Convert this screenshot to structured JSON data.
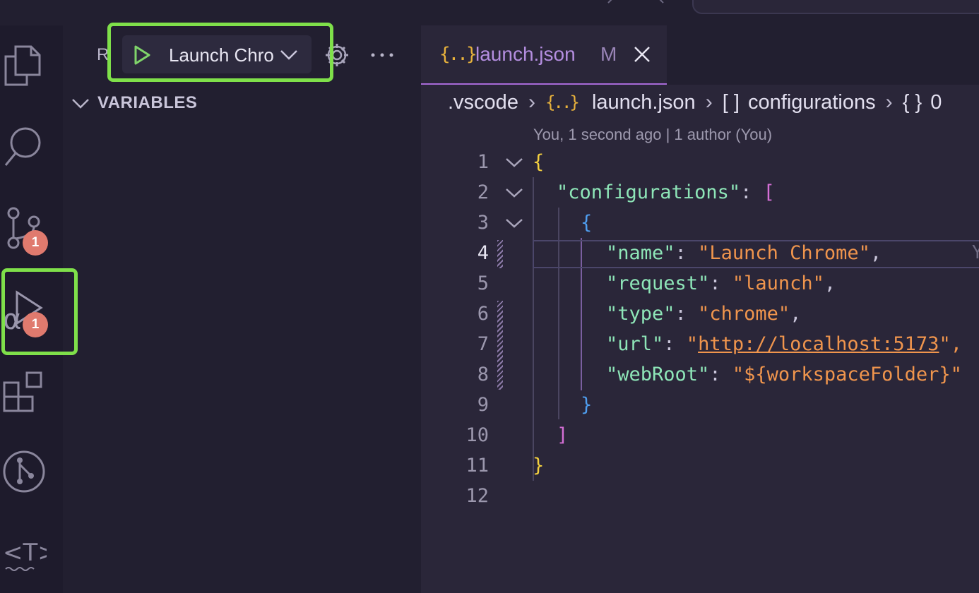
{
  "sidebar": {
    "title_truncated": "R",
    "launch_config": "Launch Chrome",
    "section_variables": "VARIABLES"
  },
  "activity": {
    "scm_badge": "1",
    "debug_badge": "1",
    "icons": [
      "explorer-icon",
      "search-icon",
      "source-control-icon",
      "run-debug-icon",
      "extensions-icon",
      "git-graph-icon",
      "text-icon"
    ]
  },
  "tab": {
    "icon": "{..}",
    "name": "launch.json",
    "modified": "M"
  },
  "breadcrumb": {
    "folder": ".vscode",
    "file_icon": "{..}",
    "file": "launch.json",
    "array_icon": "[ ]",
    "array": "configurations",
    "object_icon": "{ }",
    "object_truncated": "0"
  },
  "codelens": "You, 1 second ago | 1 author (You)",
  "inline_blame": "Y",
  "lines": [
    {
      "n": "1"
    },
    {
      "n": "2"
    },
    {
      "n": "3"
    },
    {
      "n": "4"
    },
    {
      "n": "5"
    },
    {
      "n": "6"
    },
    {
      "n": "7"
    },
    {
      "n": "8"
    },
    {
      "n": "9"
    },
    {
      "n": "10"
    },
    {
      "n": "11"
    },
    {
      "n": "12"
    }
  ],
  "code": {
    "open_brace": "{",
    "configurations_key": "\"configurations\"",
    "colon": ": ",
    "open_bracket": "[",
    "inner_open": "{",
    "name_key": "\"name\"",
    "name_val": "\"Launch Chrome\"",
    "request_key": "\"request\"",
    "request_val": "\"launch\"",
    "type_key": "\"type\"",
    "type_val": "\"chrome\"",
    "url_key": "\"url\"",
    "url_quote": "\"",
    "url_val": "http://localhost:5173",
    "url_end": "\",",
    "webroot_key": "\"webRoot\"",
    "webroot_val": "\"${workspaceFolder}\"",
    "comma": ",",
    "inner_close": "}",
    "close_bracket": "]",
    "close_brace": "}"
  },
  "colors": {
    "highlight": "#7fe04a",
    "badge": "#e07a6e",
    "accent": "#a86ad8"
  }
}
